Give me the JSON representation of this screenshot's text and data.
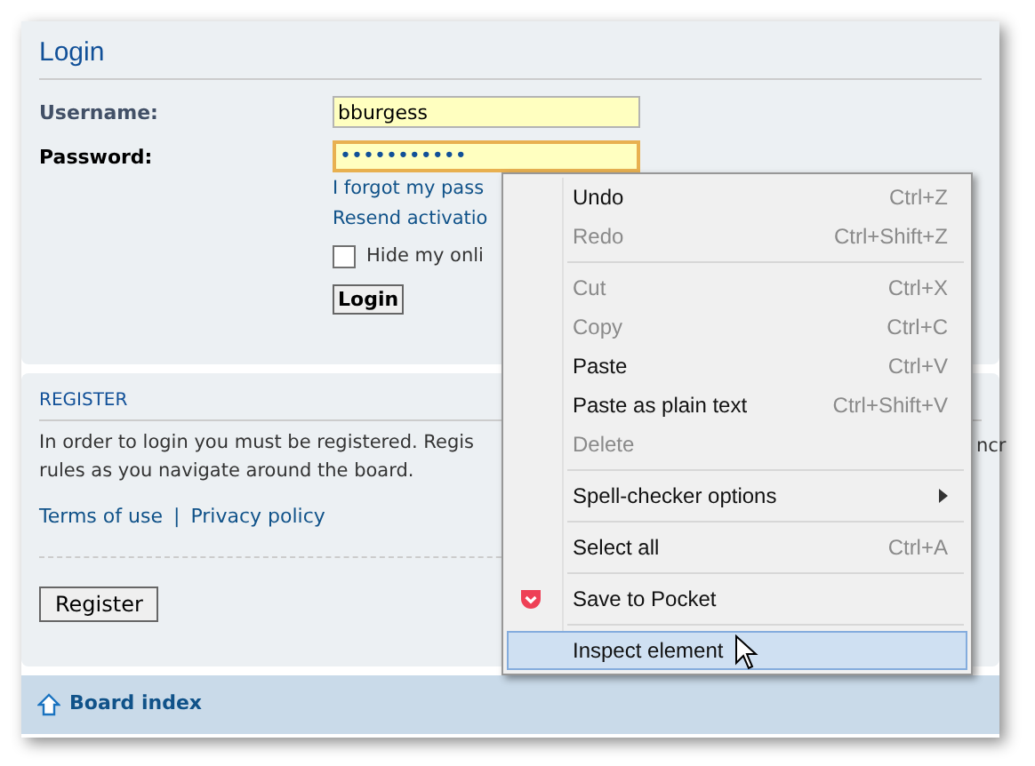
{
  "login": {
    "title": "Login",
    "fields": [
      {
        "label": "Username:",
        "value": "bburgess",
        "kind": "text",
        "focused": false
      },
      {
        "label": "Password:",
        "value": "•••••••••••",
        "kind": "password",
        "focused": true
      }
    ],
    "links": [
      "I forgot my pass",
      "Resend activatio"
    ],
    "checkbox": {
      "label": "Hide my onli",
      "checked": false
    },
    "button": "Login"
  },
  "register": {
    "heading": "REGISTER",
    "lines": [
      "In order to login you must be registered. Regis",
      "rules as you navigate around the board."
    ],
    "fragment": "ncr",
    "links": [
      "Terms of use",
      "Privacy policy"
    ],
    "link_separator": "|",
    "button": "Register"
  },
  "footer": {
    "breadcrumb": "Board index"
  },
  "context_menu": [
    {
      "kind": "item",
      "label": "Undo",
      "shortcut": "Ctrl+Z",
      "disabled": false,
      "selected": false
    },
    {
      "kind": "item",
      "label": "Redo",
      "shortcut": "Ctrl+Shift+Z",
      "disabled": true,
      "selected": false
    },
    {
      "kind": "separator"
    },
    {
      "kind": "item",
      "label": "Cut",
      "shortcut": "Ctrl+X",
      "disabled": true,
      "selected": false
    },
    {
      "kind": "item",
      "label": "Copy",
      "shortcut": "Ctrl+C",
      "disabled": true,
      "selected": false
    },
    {
      "kind": "item",
      "label": "Paste",
      "shortcut": "Ctrl+V",
      "disabled": false,
      "selected": false
    },
    {
      "kind": "item",
      "label": "Paste as plain text",
      "shortcut": "Ctrl+Shift+V",
      "disabled": false,
      "selected": false
    },
    {
      "kind": "item",
      "label": "Delete",
      "disabled": true,
      "selected": false
    },
    {
      "kind": "separator"
    },
    {
      "kind": "submenu",
      "label": "Spell-checker options",
      "disabled": false,
      "selected": false
    },
    {
      "kind": "separator"
    },
    {
      "kind": "item",
      "label": "Select all",
      "shortcut": "Ctrl+A",
      "disabled": false,
      "selected": false
    },
    {
      "kind": "separator"
    },
    {
      "kind": "icon_item",
      "label": "Save to Pocket",
      "disabled": false,
      "selected": false
    },
    {
      "kind": "separator"
    },
    {
      "kind": "item",
      "label": "Inspect element",
      "disabled": false,
      "selected": true
    }
  ]
}
